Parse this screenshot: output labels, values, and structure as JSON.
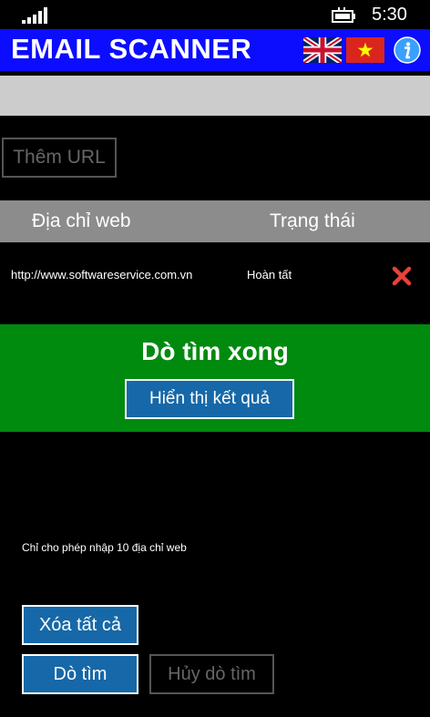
{
  "status_bar": {
    "time": "5:30",
    "signal_icon": "signal-strength-icon",
    "battery_icon": "battery-charging-icon"
  },
  "header": {
    "title": "EMAIL SCANNER",
    "language_flags": [
      "uk-flag-icon",
      "vietnam-flag-icon"
    ],
    "info_icon": "info-icon"
  },
  "url_input": {
    "value": "",
    "placeholder": ""
  },
  "add_url_button": "Thêm URL",
  "table": {
    "columns": [
      "Địa chỉ web",
      "Trạng thái"
    ],
    "rows": [
      {
        "url": "http://www.softwareservice.com.vn",
        "status": "Hoàn tất",
        "action_icon": "delete-icon"
      }
    ]
  },
  "done_panel": {
    "title": "Dò tìm xong",
    "results_button": "Hiển thị kết quả"
  },
  "note": "Chỉ cho phép nhập 10 địa chỉ web",
  "buttons": {
    "clear_all": "Xóa tất cả",
    "scan": "Dò tìm",
    "cancel_scan": "Hủy dò tìm"
  },
  "colors": {
    "header_bg": "#0c0cff",
    "done_bg": "#008a0e",
    "button_bg": "#1668a8",
    "table_header_bg": "#8c8c8c",
    "delete_red": "#e8413a"
  }
}
